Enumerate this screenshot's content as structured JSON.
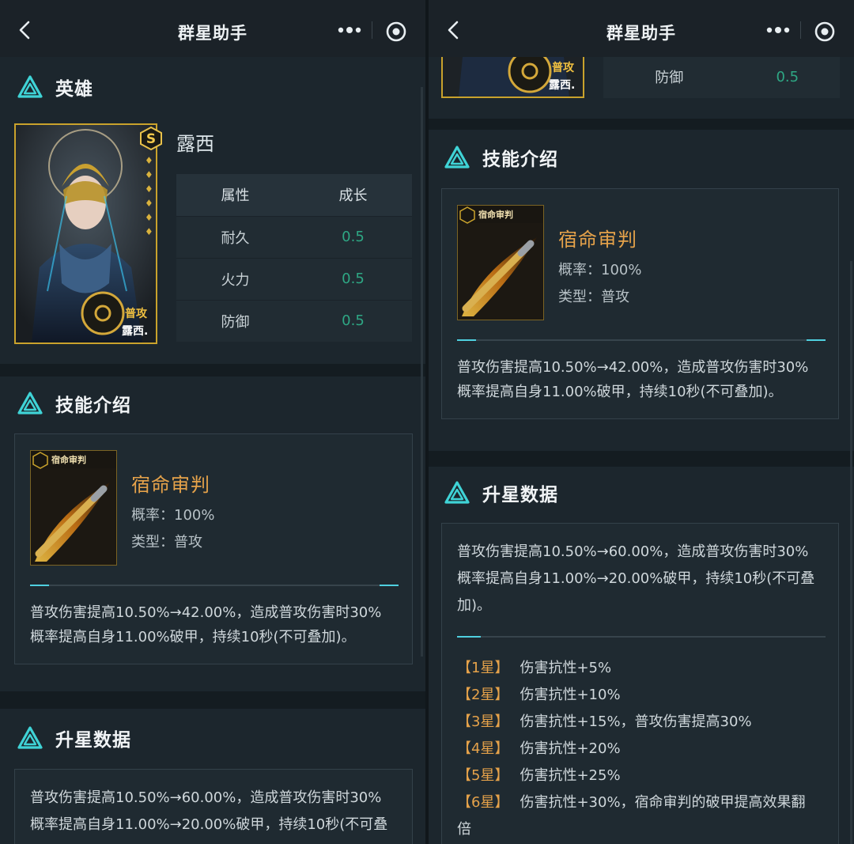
{
  "app": {
    "title": "群星助手"
  },
  "sections": {
    "hero": "英雄",
    "skill": "技能介绍",
    "star": "升星数据"
  },
  "hero": {
    "name": "露西",
    "rarity": "S",
    "card_tag": "普攻",
    "card_name": "露西."
  },
  "attributes": {
    "headers": [
      "属性",
      "成长"
    ],
    "rows": [
      {
        "name": "耐久",
        "value": "0.5"
      },
      {
        "name": "火力",
        "value": "0.5"
      },
      {
        "name": "防御",
        "value": "0.5"
      }
    ]
  },
  "skill": {
    "icon_label": "宿命审判",
    "name": "宿命审判",
    "rate": "概率：100%",
    "type": "类型：普攻",
    "desc_1": "普攻伤害提高10.50%→42.00%，造成普攻伤害时30%",
    "desc_2": "概率提高自身11.00%破甲，持续10秒(不可叠加)。"
  },
  "star_data": {
    "desc_1": "普攻伤害提高10.50%→60.00%，造成普攻伤害时30%",
    "desc_2": "概率提高自身11.00%→20.00%破甲，持续10秒(不可叠",
    "desc_3": "加)。",
    "levels": [
      {
        "star": "【1星】",
        "text": "伤害抗性+5%"
      },
      {
        "star": "【2星】",
        "text": "伤害抗性+10%"
      },
      {
        "star": "【3星】",
        "text": "伤害抗性+15%，普攻伤害提高30%"
      },
      {
        "star": "【4星】",
        "text": "伤害抗性+20%"
      },
      {
        "star": "【5星】",
        "text": "伤害抗性+25%"
      },
      {
        "star": "【6星】",
        "text": "伤害抗性+30%，宿命审判的破甲提高效果翻"
      },
      {
        "star": "",
        "text": "倍"
      }
    ]
  },
  "colors": {
    "accent_teal": "#2ea784",
    "skill_gold": "#e5a24a",
    "card_gold": "#c9a22c",
    "background": "#1c262d"
  },
  "icons": [
    "back-chevron",
    "more-dots",
    "target-circle",
    "triangle-logo",
    "rarity-s-badge"
  ]
}
